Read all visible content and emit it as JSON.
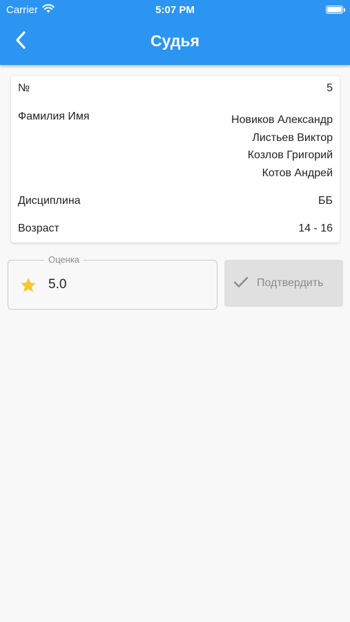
{
  "status_bar": {
    "carrier": "Carrier",
    "time": "5:07 PM"
  },
  "header": {
    "title": "Судья"
  },
  "details": {
    "number_label": "№",
    "number_value": "5",
    "name_label": "Фамилия Имя",
    "names": [
      "Новиков Александр",
      "Листьев Виктор",
      "Козлов Григорий",
      "Котов Андрей"
    ],
    "discipline_label": "Дисциплина",
    "discipline_value": "ББ",
    "age_label": "Возраст",
    "age_value": "14 - 16"
  },
  "rating": {
    "label": "Оценка",
    "value": "5.0",
    "star_color": "#f9c72c"
  },
  "confirm_button": {
    "label": "Подтвердить"
  },
  "colors": {
    "accent": "#2b95f1",
    "background": "#f8f8f8",
    "disabled_button": "#e0e0e0"
  },
  "icons": {
    "back": "chevron-left-icon",
    "rating": "star-icon",
    "confirm": "check-icon"
  }
}
